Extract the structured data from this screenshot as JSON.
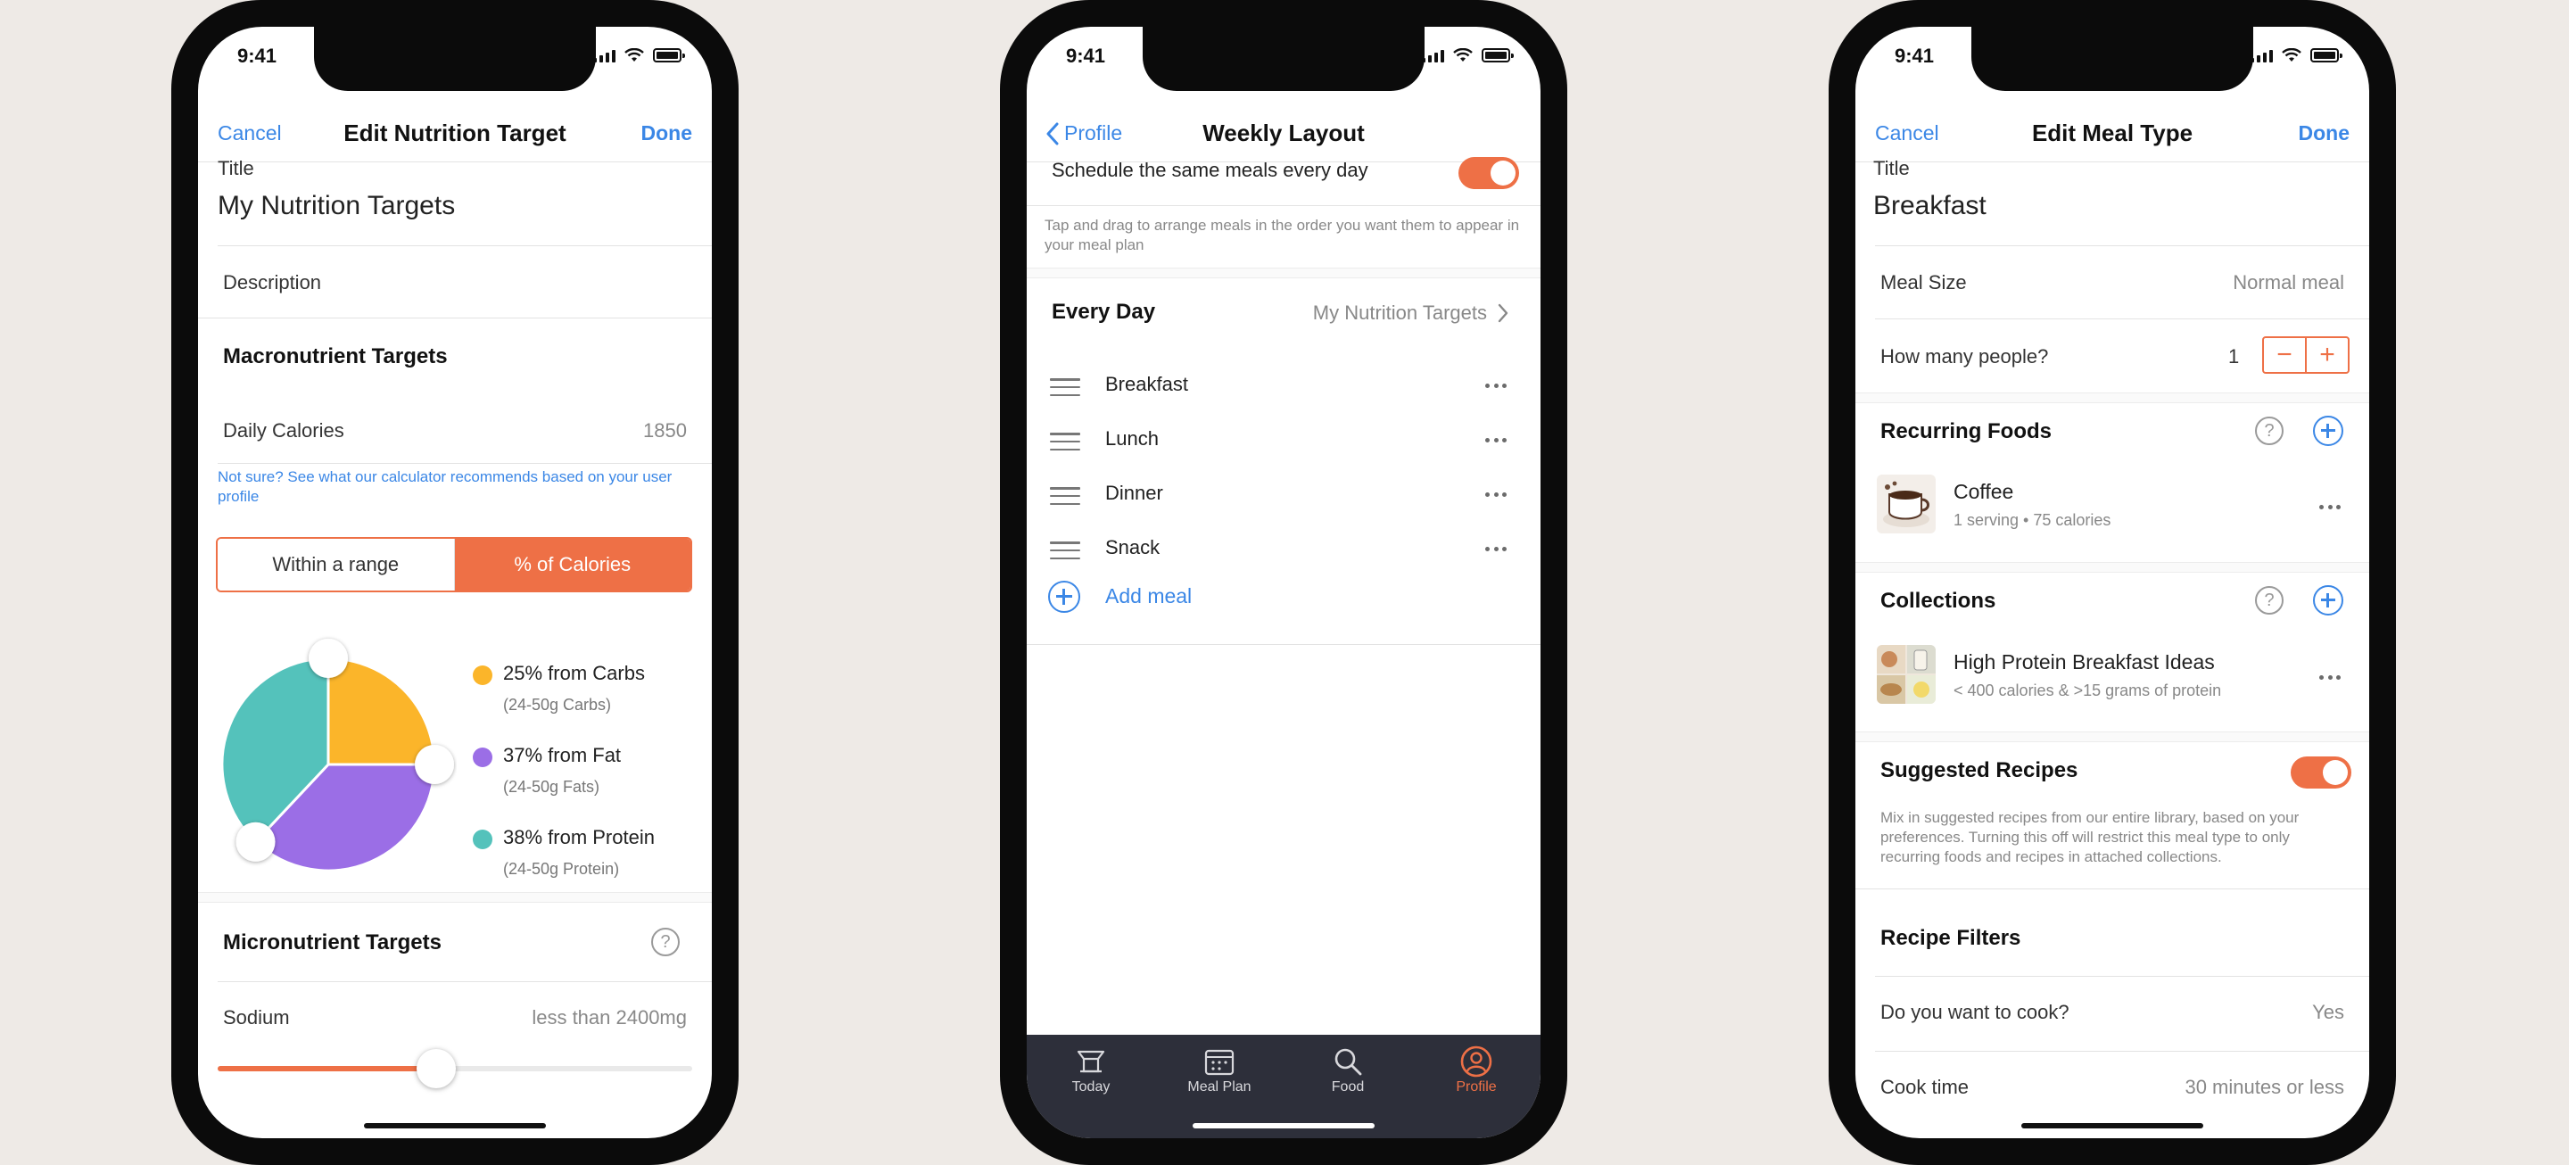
{
  "status_time": "9:41",
  "colors": {
    "accent": "#ee7046",
    "link": "#3b87e6",
    "carbs": "#fbb52a",
    "fat": "#9b6ee6",
    "protein": "#54c2bb",
    "tabbar": "#2d2f3a"
  },
  "screen1": {
    "nav": {
      "left": "Cancel",
      "title": "Edit Nutrition Target",
      "right": "Done"
    },
    "title_label": "Title",
    "title_value": "My Nutrition Targets",
    "description_label": "Description",
    "macro_header": "Macronutrient Targets",
    "daily_calories_label": "Daily Calories",
    "daily_calories_value": "1850",
    "calc_note": "Not sure? See what our calculator recommends based on your user profile",
    "segment": {
      "range": "Within a range",
      "percent": "% of Calories",
      "selected": "percent"
    },
    "macros": [
      {
        "name": "carbs",
        "percent": 25,
        "label": "25% from Carbs",
        "sub": "(24-50g Carbs)"
      },
      {
        "name": "fat",
        "percent": 37,
        "label": "37% from Fat",
        "sub": "(24-50g Fats)"
      },
      {
        "name": "protein",
        "percent": 38,
        "label": "38% from Protein",
        "sub": "(24-50g Protein)"
      }
    ],
    "micro_header": "Micronutrient Targets",
    "help_glyph": "?",
    "sodium_label": "Sodium",
    "sodium_value": "less than 2400mg",
    "sodium_slider_fraction": 0.46
  },
  "screen2": {
    "nav": {
      "back": "Profile",
      "title": "Weekly Layout"
    },
    "same_meals_label": "Schedule the same meals every day",
    "same_meals_on": true,
    "hint": "Tap and drag to arrange meals in the order you want them to appear in your meal plan",
    "every_day": "Every Day",
    "target_link": "My Nutrition Targets",
    "meals": [
      "Breakfast",
      "Lunch",
      "Dinner",
      "Snack"
    ],
    "add_meal": "Add meal",
    "tabs": [
      {
        "label": "Today",
        "icon": "tray-icon"
      },
      {
        "label": "Meal Plan",
        "icon": "calendar-icon"
      },
      {
        "label": "Food",
        "icon": "search-icon"
      },
      {
        "label": "Profile",
        "icon": "profile-icon",
        "active": true
      }
    ]
  },
  "screen3": {
    "nav": {
      "left": "Cancel",
      "title": "Edit Meal Type",
      "right": "Done"
    },
    "title_label": "Title",
    "title_value": "Breakfast",
    "meal_size_label": "Meal Size",
    "meal_size_value": "Normal meal",
    "people_label": "How many people?",
    "people_value": "1",
    "stepper_minus": "−",
    "stepper_plus": "+",
    "recurring_header": "Recurring Foods",
    "recurring_item": {
      "name": "Coffee",
      "detail": "1 serving • 75 calories"
    },
    "collections_header": "Collections",
    "collection_item": {
      "name": "High Protein Breakfast Ideas",
      "detail": "< 400 calories & >15 grams of protein"
    },
    "suggested_header": "Suggested Recipes",
    "suggested_on": true,
    "suggested_note": "Mix in suggested recipes from our entire library, based on your preferences. Turning this off will restrict this meal type to only recurring foods and recipes in attached collections.",
    "filters_header": "Recipe Filters",
    "cook_label": "Do you want to cook?",
    "cook_value": "Yes",
    "cook_time_label": "Cook time",
    "cook_time_value": "30 minutes or less"
  }
}
